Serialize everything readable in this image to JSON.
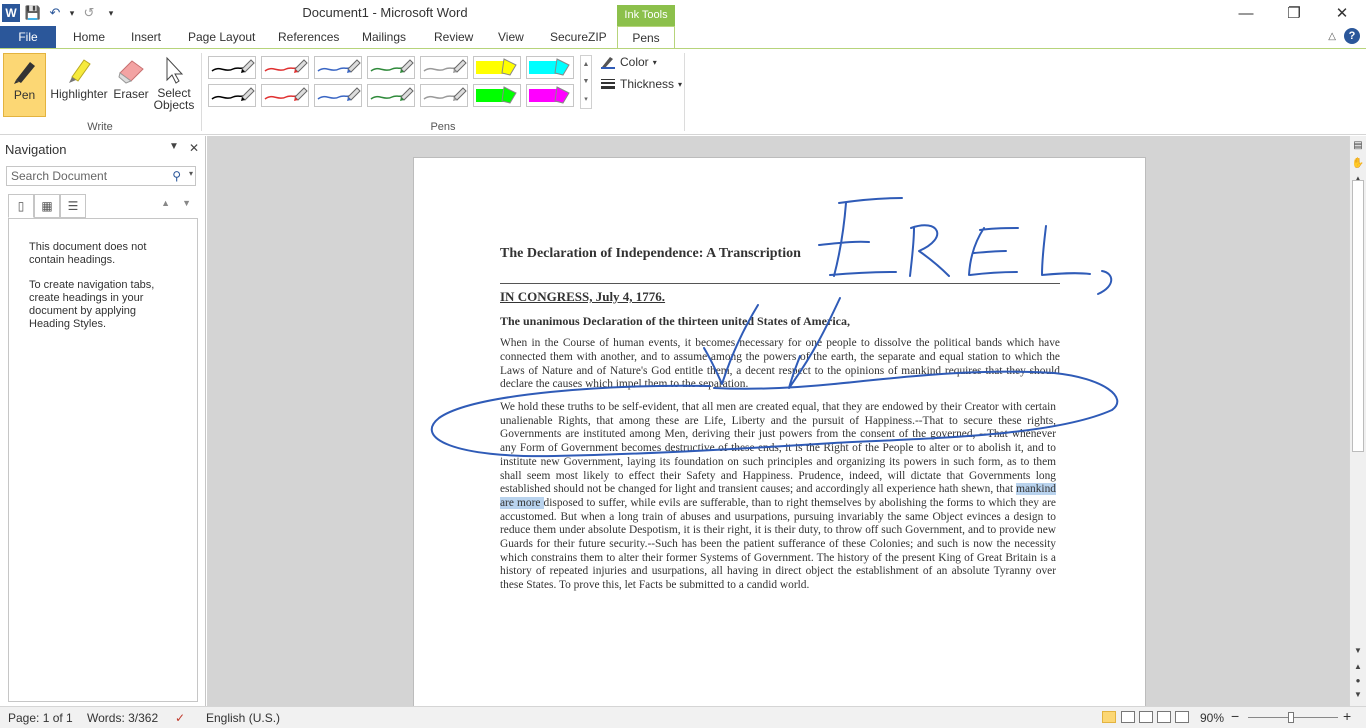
{
  "window": {
    "title": "Document1 - Microsoft Word",
    "app_logo": "W",
    "controls": [
      "—",
      "❐",
      "✕"
    ]
  },
  "qat": {
    "save_icon": "💾",
    "undo_icon": "↶",
    "undo_dd": "▾",
    "redo_icon": "↺",
    "customize_icon": "▾"
  },
  "tabs": {
    "file": "File",
    "home": "Home",
    "insert": "Insert",
    "page_layout": "Page Layout",
    "references": "References",
    "mailings": "Mailings",
    "review": "Review",
    "view": "View",
    "securezip": "SecureZIP",
    "contextual": "Ink Tools",
    "pens": "Pens",
    "collapse_icon": "△",
    "help_icon": "?"
  },
  "ribbon": {
    "write": {
      "label": "Write",
      "pen": "Pen",
      "highlighter": "Highlighter",
      "eraser": "Eraser",
      "select_line1": "Select",
      "select_line2": "Objects"
    },
    "pens": {
      "label": "Pens",
      "swatches_row1": [
        "#000000",
        "#e03030",
        "#3a66c4",
        "#2f8a3a",
        "#9a9a9a",
        "#ffff00",
        "#00ffff"
      ],
      "swatches_row2": [
        "#000000",
        "#e03030",
        "#3a66c4",
        "#2f8a3a",
        "#9a9a9a",
        "#00ff00",
        "#ff00ff"
      ],
      "scroll_up": "▲",
      "scroll_down": "▼",
      "scroll_more": "▾",
      "color": "Color",
      "color_dd": "▾",
      "thickness": "Thickness",
      "thickness_dd": "▾"
    }
  },
  "navigation": {
    "title": "Navigation",
    "dd_icon": "▼",
    "close_icon": "✕",
    "search_placeholder": "Search Document",
    "search_icon": "⚲",
    "search_dd": "▾",
    "view_icons": [
      "▯",
      "▦",
      "☰"
    ],
    "prev": "▲",
    "next": "▼",
    "msg1": "This document does not contain headings.",
    "msg2": "To create navigation tabs, create headings in your document by applying Heading Styles."
  },
  "document": {
    "title": "The Declaration  of Independence:  A Transcription",
    "congress": "IN CONGRESS, July 4, 1776.",
    "subtitle": "The unanimous Declaration of the thirteen united States of America,",
    "p1": "When in the Course of human events, it becomes necessary for one people to dissolve the political  bands which have connected them with another, and to assume among the powers of the earth, the separate and equal station to which the Laws of Nature and of Nature's God entitle them, a decent respect to the opinions of mankind requires that they should declare the causes which impel  them to the separation.",
    "p2_before": "We hold these truths to be self-evident,  that all men are created equal, that they are endowed by their Creator with certain  unalienable  Rights, that among these are Life, Liberty and the pursuit of Happiness.--That to secure these rights, Governments are instituted  among Men, deriving their just powers from the consent of the governed, --That whenever any Form of Government becomes destructive of these ends, it is the Right of the People to alter or to abolish it, and to institute new Government, laying its foundation on such principles and organizing its powers in such form, as to them shall seem most likely to effect their Safety and Happiness. Prudence, indeed, will dictate that Governments long established should not be changed for light and transient causes; and accordingly all experience hath shewn, that ",
    "p2_highlight": "mankind  are more ",
    "p2_after": "disposed to suffer, while evils are sufferable, than to right themselves by abolishing the forms to which they are accustomed. But when a long train of abuses and usurpations, pursuing invariably the same Object evinces  a design to reduce them under absolute Despotism, it is their right, it is their duty, to throw off such Government, and to provide new Guards for their future security.--Such has been the patient sufferance of these Colonies; and such is now the necessity which constrains  them to alter their former Systems of Government. The history of the present King of Great Britain is a history of repeated  injuries and usurpations, all having in direct object the establishment of an absolute Tyranny over these States. To prove this, let Facts be submitted to a candid world.",
    "ink_color": "#2f5bb7"
  },
  "scrollbar": {
    "up": "▲",
    "down": "▼",
    "prev_page": "▲",
    "select_browse": "●",
    "next_page": "▼"
  },
  "status": {
    "page": "Page: 1 of 1",
    "words": "Words: 3/362",
    "proofing_icon": "✓",
    "language": "English (U.S.)",
    "zoom": "90%",
    "zoom_out": "−",
    "zoom_in": "+"
  }
}
